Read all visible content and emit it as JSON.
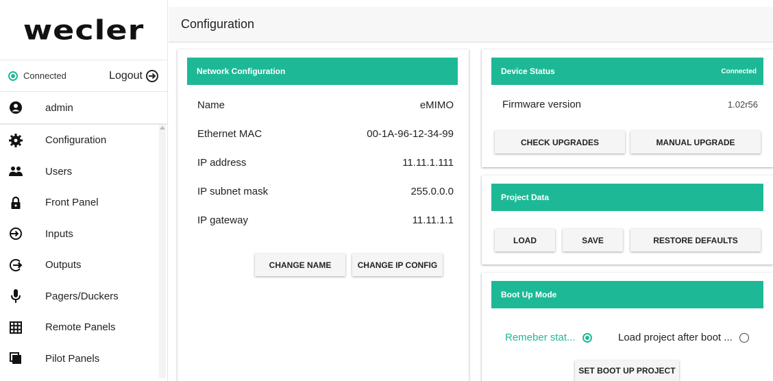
{
  "brand": {
    "logo_text": "wecler"
  },
  "session": {
    "status": "Connected",
    "logout_label": "Logout",
    "username": "admin"
  },
  "sidebar": {
    "items": [
      {
        "label": "Configuration",
        "icon": "gear-icon"
      },
      {
        "label": "Users",
        "icon": "users-icon"
      },
      {
        "label": "Front Panel",
        "icon": "lock-icon"
      },
      {
        "label": "Inputs",
        "icon": "input-icon"
      },
      {
        "label": "Outputs",
        "icon": "output-icon"
      },
      {
        "label": "Pagers/Duckers",
        "icon": "microphone-icon"
      },
      {
        "label": "Remote Panels",
        "icon": "grid-icon"
      },
      {
        "label": "Pilot Panels",
        "icon": "pilot-panel-icon"
      }
    ]
  },
  "header": {
    "title": "Configuration"
  },
  "network": {
    "title": "Network Configuration",
    "rows": [
      {
        "label": "Name",
        "value": "eMIMO"
      },
      {
        "label": "Ethernet MAC",
        "value": "00-1A-96-12-34-99"
      },
      {
        "label": "IP address",
        "value": "11.11.1.111"
      },
      {
        "label": "IP subnet mask",
        "value": "255.0.0.0"
      },
      {
        "label": "IP gateway",
        "value": "11.11.1.1"
      }
    ],
    "change_name_label": "CHANGE NAME",
    "change_ip_label": "CHANGE IP CONFIG"
  },
  "device_status": {
    "title": "Device Status",
    "status": "Connected",
    "firmware_label": "Firmware version",
    "firmware_value": "1.02r56",
    "check_upgrades_label": "CHECK UPGRADES",
    "manual_upgrade_label": "MANUAL UPGRADE"
  },
  "project_data": {
    "title": "Project Data",
    "load_label": "LOAD",
    "save_label": "SAVE",
    "restore_label": "RESTORE DEFAULTS"
  },
  "boot_mode": {
    "title": "Boot Up Mode",
    "option_remember": "Remeber stat...",
    "option_load": "Load project after boot ...",
    "selected": "remember",
    "set_boot_label": "SET BOOT UP PROJECT"
  },
  "colors": {
    "accent": "#1db996"
  }
}
